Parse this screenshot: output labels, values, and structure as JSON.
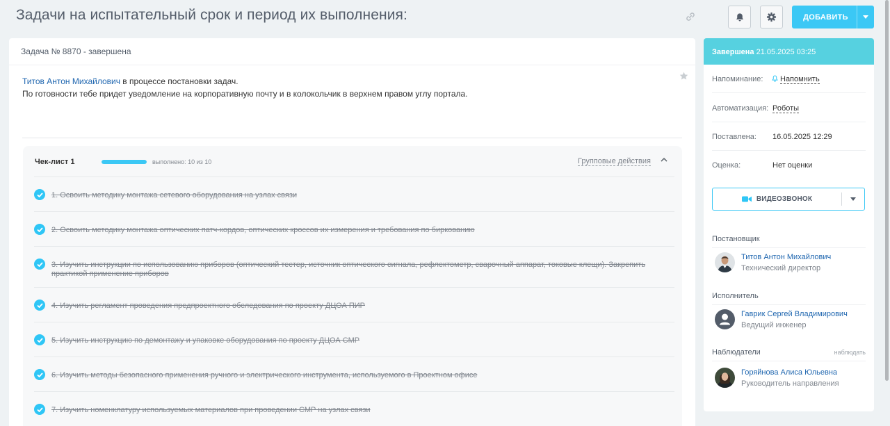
{
  "page": {
    "title": "Задачи на испытательный срок и период их выполнения:",
    "add_button": "ДОБАВИТЬ"
  },
  "task": {
    "header": "Задача № 8870 - завершена",
    "author_link": "Титов Антон Михайлович",
    "description_line1_rest": " в процессе постановки задач.",
    "description_line2": "По готовности тебе придет уведомление на корпоративную почту и в колокольчик в верхнем правом углу портала."
  },
  "checklist": {
    "title": "Чек-лист 1",
    "progress_label": "выполнено: 10 из 10",
    "progress_fraction": 1.0,
    "group_actions": "Групповые действия",
    "items": [
      {
        "text": "1. Освоить методику монтажа сетевого оборудования на узлах связи",
        "done": true
      },
      {
        "text": "2. Освоить методику монтажа оптических патч-кордов, оптических кроссов их измерения и требования по биркованию",
        "done": true
      },
      {
        "text": "3. Изучить инструкции по использованию приборов (оптический тестер, источник оптического сигнала, рефлектометр, сварочный аппарат, токовые клещи). Закрепить практикой применение приборов",
        "done": true
      },
      {
        "text": "4. Изучить регламент проведения предпроектного обследования по проекту ДЦОА ПИР",
        "done": true
      },
      {
        "text": "5. Изучить инструкцию по демонтажу и упаковке оборудования по проекту ДЦОА СМР",
        "done": true
      },
      {
        "text": "6. Изучить методы безопасного применения ручного и электрического инструмента, используемого в Проектном офисе",
        "done": true
      },
      {
        "text": "7. Изучить номенклатуру используемых материалов при проведении СМР на узлах связи",
        "done": true
      }
    ]
  },
  "sidebar": {
    "status_label": "Завершена",
    "status_date": " 21.05.2025 03:25",
    "status_color": "#56d1e0",
    "rows": [
      {
        "key": "Напоминание:",
        "value": "Напомнить"
      },
      {
        "key": "Автоматизация:",
        "value": "Роботы"
      },
      {
        "key": "Поставлена:",
        "value": "16.05.2025 12:29"
      },
      {
        "key": "Оценка:",
        "value": "Нет оценки"
      }
    ],
    "video_button": "ВИДЕОЗВОНОК",
    "creator_title": "Постановщик",
    "creator": {
      "name": "Титов Антон Михайлович",
      "position": "Технический директор"
    },
    "responsible_title": "Исполнитель",
    "responsible": {
      "name": "Гаврик Сергей Владимирович",
      "position": "Ведущий инженер"
    },
    "observers_title": "Наблюдатели",
    "observers_action": "наблюдать",
    "observer": {
      "name": "Горяйнова Алиса Юльевна",
      "position": "Руководитель направления"
    }
  },
  "colors": {
    "accent": "#3bc8f5",
    "link": "#2067b0"
  }
}
